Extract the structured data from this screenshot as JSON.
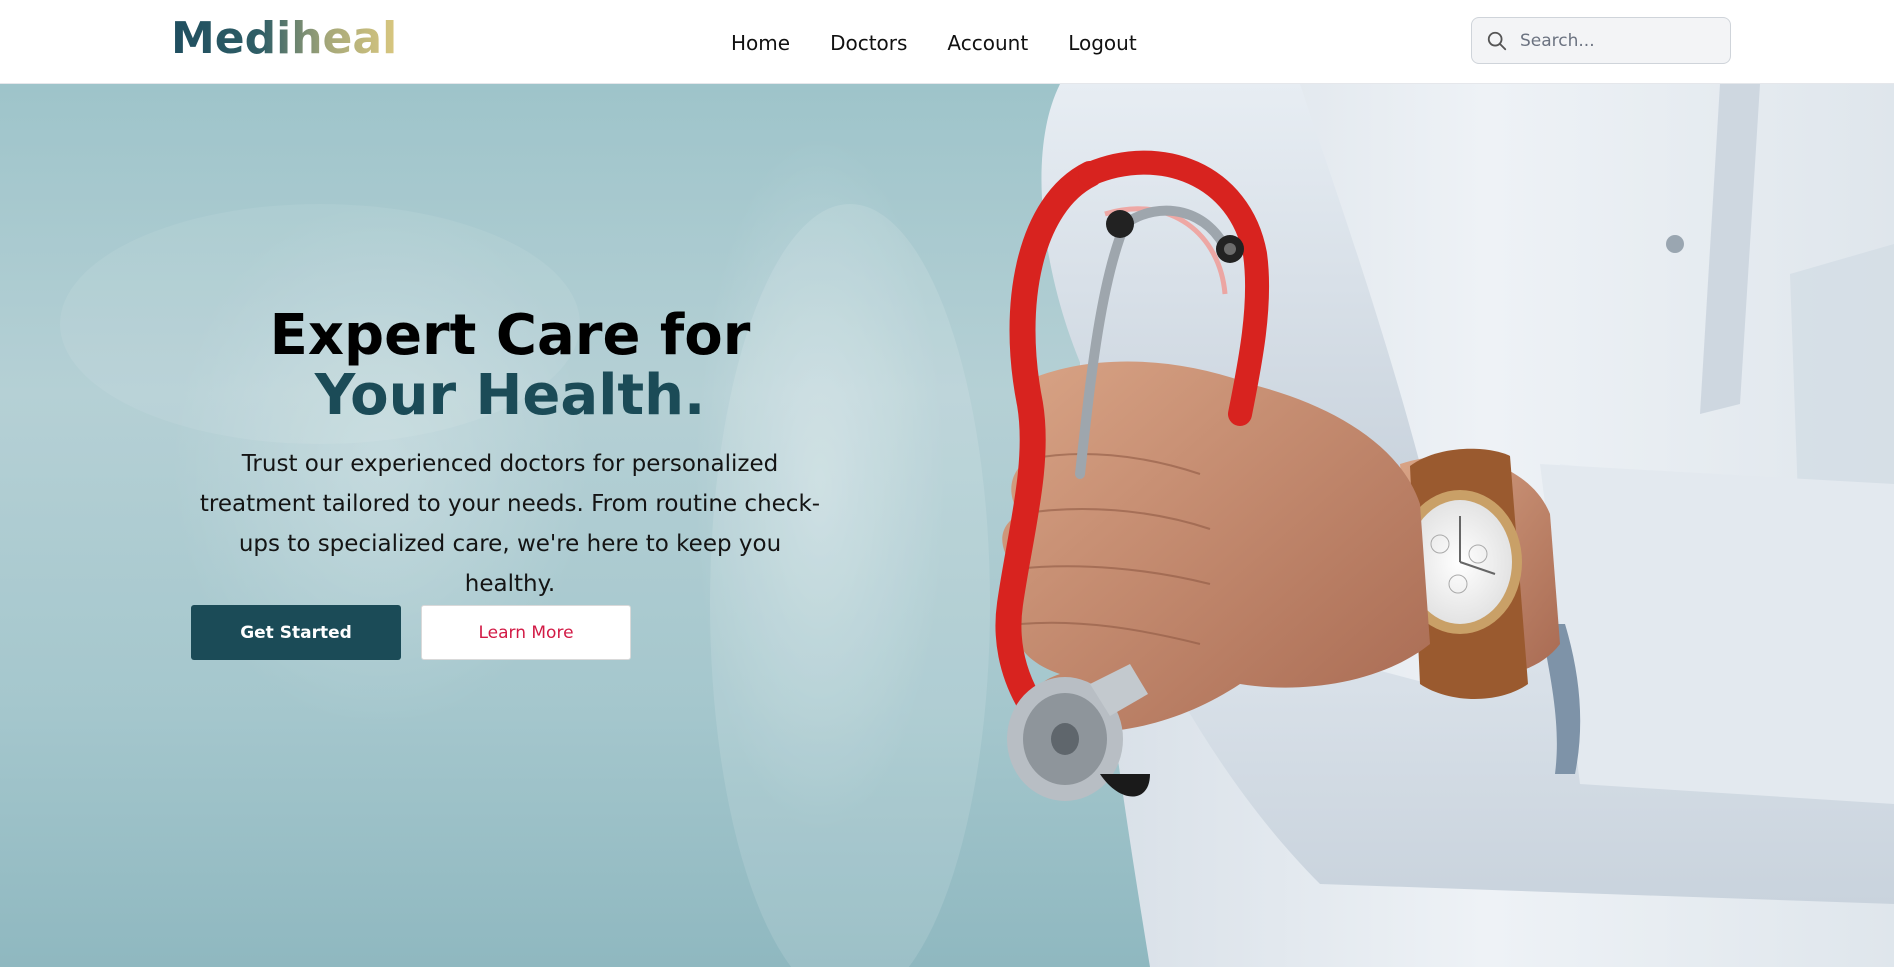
{
  "nav": {
    "logo_text": "Mediheal",
    "links": [
      "Home",
      "Doctors",
      "Account",
      "Logout"
    ],
    "search_placeholder": "Search..."
  },
  "hero": {
    "headline_line1": "Expert Care for",
    "headline_line2": "Your Health.",
    "description": "Trust our experienced doctors for personalized treatment tailored to your needs. From routine check-ups to specialized care, we're here to keep you healthy.",
    "primary_button": "Get Started",
    "secondary_button": "Learn More",
    "image_subject": "doctor-with-red-stethoscope"
  },
  "colors": {
    "brand_dark": "#1b4b57",
    "accent_red": "#d21a45",
    "logo_gold": "#d9c77f"
  },
  "icons": {
    "search": "search-icon"
  }
}
